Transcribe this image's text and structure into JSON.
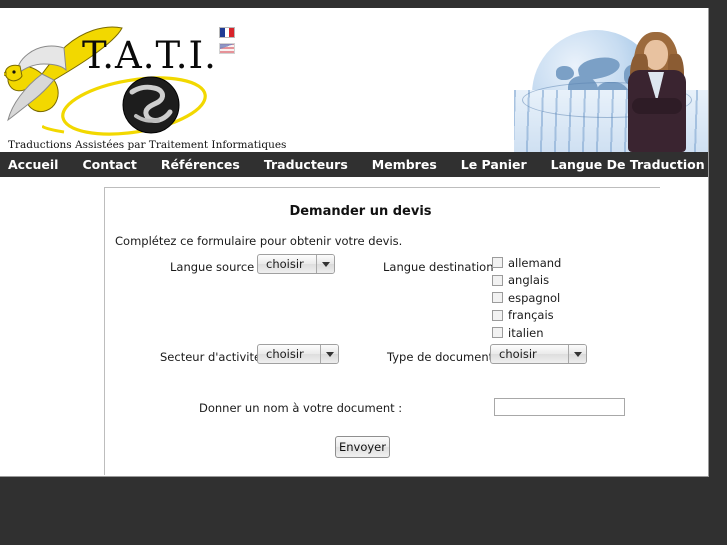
{
  "site": {
    "logo": {
      "acronym": "T.A.T.I.",
      "tagline": "Traductions Assistées par Traitement Informatiques",
      "bird_icon": "eagle-icon",
      "globe_icon": "globe-icon"
    },
    "language_flags": [
      {
        "name": "flag-fr-icon",
        "label": "Français"
      },
      {
        "name": "flag-en-icon",
        "label": "English"
      }
    ],
    "banner": {
      "name": "banner-globe-businesswoman-image"
    }
  },
  "nav": {
    "items": [
      {
        "label": "Accueil",
        "name": "nav-item-accueil"
      },
      {
        "label": "Contact",
        "name": "nav-item-contact"
      },
      {
        "label": "Références",
        "name": "nav-item-references"
      },
      {
        "label": "Traducteurs",
        "name": "nav-item-traducteurs"
      },
      {
        "label": "Membres",
        "name": "nav-item-membres"
      },
      {
        "label": "Le Panier",
        "name": "nav-item-le-panier"
      },
      {
        "label": "Langue De Traduction",
        "name": "nav-item-langue-de-traduction"
      }
    ]
  },
  "form": {
    "title": "Demander un devis",
    "intro": "Complétez ce formulaire pour obtenir votre devis.",
    "source_language": {
      "label": "Langue source",
      "value": "choisir"
    },
    "destination_language": {
      "label": "Langue destination",
      "options": [
        {
          "label": "allemand",
          "checked": false
        },
        {
          "label": "anglais",
          "checked": false
        },
        {
          "label": "espagnol",
          "checked": false
        },
        {
          "label": "français",
          "checked": false
        },
        {
          "label": "italien",
          "checked": false
        }
      ]
    },
    "activity_sector": {
      "label": "Secteur d'activité",
      "value": "choisir"
    },
    "document_type": {
      "label": "Type de document",
      "value": "choisir"
    },
    "document_name": {
      "label": "Donner un nom à votre document :",
      "value": "",
      "placeholder": ""
    },
    "submit": {
      "label": "Envoyer"
    }
  },
  "colors": {
    "chrome_dark": "#303030",
    "page_bg": "#ffffff",
    "logo_yellow": "#f2d800",
    "accent_border": "#bdbdbd"
  }
}
